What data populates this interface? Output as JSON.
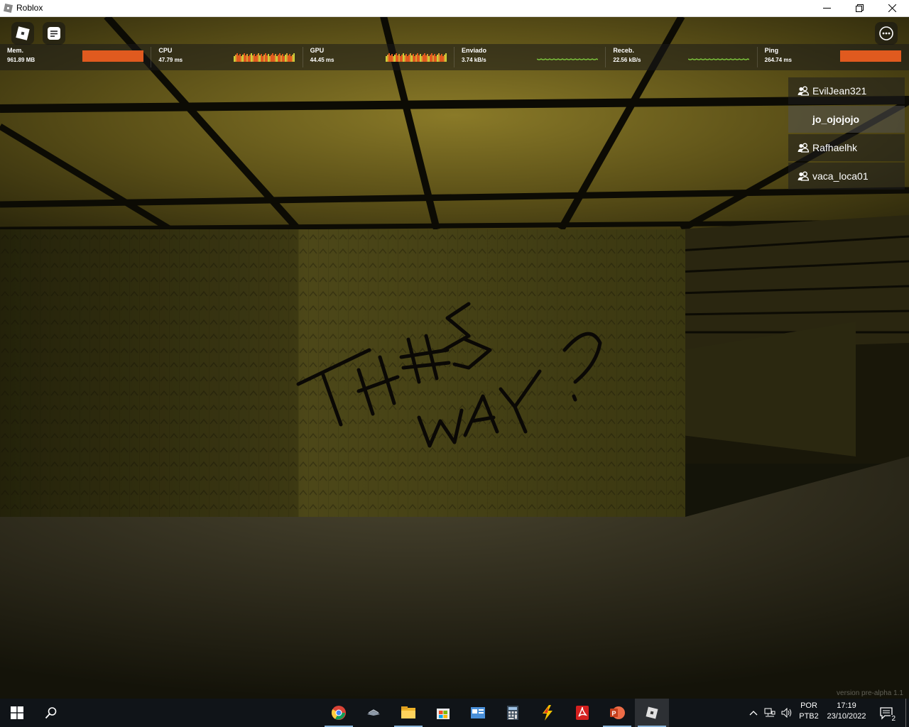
{
  "window": {
    "title": "Roblox",
    "app_icon": "roblox-window-icon",
    "controls": [
      "minimize-icon",
      "restore-icon",
      "close-icon"
    ]
  },
  "topbar": {
    "menu_icon": "roblox-logo-icon",
    "chat_icon": "chat-icon",
    "more_icon": "more-options-icon"
  },
  "stats": [
    {
      "label": "Mem.",
      "value": "961.89 MB",
      "graph": "bar",
      "color": "#e05a1f"
    },
    {
      "label": "CPU",
      "value": "47.79 ms",
      "graph": "bars",
      "color": "#e05a1f"
    },
    {
      "label": "GPU",
      "value": "44.45 ms",
      "graph": "bars",
      "color": "#e05a1f"
    },
    {
      "label": "Enviado",
      "value": "3.74 kB/s",
      "graph": "line",
      "color": "#7bc23c"
    },
    {
      "label": "Receb.",
      "value": "22.56 kB/s",
      "graph": "line",
      "color": "#7bc23c"
    },
    {
      "label": "Ping",
      "value": "264.74 ms",
      "graph": "bar",
      "color": "#e05a1f"
    }
  ],
  "players": [
    {
      "name": "EvilJean321",
      "icon": "friend-icon",
      "local": false
    },
    {
      "name": "jo_ojojojo",
      "icon": "",
      "local": true
    },
    {
      "name": "Rafhaelhk",
      "icon": "friend-icon",
      "local": false
    },
    {
      "name": "vaca_loca01",
      "icon": "friend-icon",
      "local": false
    }
  ],
  "scene": {
    "wall_text_line1": "THIS",
    "wall_text_line2": "WAY?"
  },
  "version_text": "version pre-alpha 1.1",
  "taskbar": {
    "start_icon": "windows-start-icon",
    "search_icon": "search-icon",
    "apps": [
      {
        "name": "chrome-icon",
        "active": false,
        "underline": true
      },
      {
        "name": "window-manager-icon",
        "active": false,
        "underline": false
      },
      {
        "name": "file-explorer-icon",
        "active": false,
        "underline": true
      },
      {
        "name": "microsoft-store-icon",
        "active": false,
        "underline": false
      },
      {
        "name": "control-panel-icon",
        "active": false,
        "underline": false
      },
      {
        "name": "calculator-icon",
        "active": false,
        "underline": false
      },
      {
        "name": "flash-icon",
        "active": false,
        "underline": false
      },
      {
        "name": "acrobat-icon",
        "active": false,
        "underline": false
      },
      {
        "name": "powerpoint-icon",
        "active": false,
        "underline": true
      },
      {
        "name": "roblox-icon",
        "active": true,
        "underline": true
      }
    ],
    "tray": {
      "chevron_icon": "chevron-up-icon",
      "network_icon": "network-icon",
      "volume_icon": "volume-icon",
      "lang_line1": "POR",
      "lang_line2": "PTB2",
      "time": "17:19",
      "date": "23/10/2022",
      "notification_icon": "notification-icon",
      "notification_count": "2"
    }
  }
}
